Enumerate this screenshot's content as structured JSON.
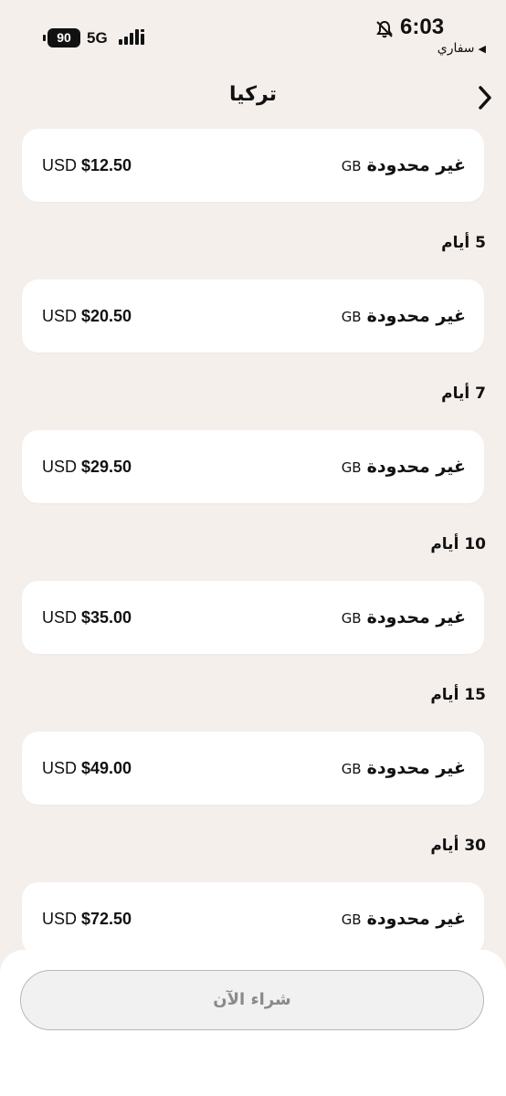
{
  "status_bar": {
    "battery": "90",
    "network": "5G",
    "time": "6:03",
    "back_app": "سفاري",
    "icons": [
      "battery-icon",
      "signal-icon",
      "bell-slash-icon",
      "back-triangle-icon"
    ]
  },
  "nav": {
    "title": "تركيا",
    "back_icon": "chevron-right-icon"
  },
  "plans": [
    {
      "days": "",
      "data": "غير محدودة",
      "unit": "GB",
      "currency": "USD",
      "price": "$12.50"
    },
    {
      "days": "5 أيام",
      "data": "غير محدودة",
      "unit": "GB",
      "currency": "USD",
      "price": "$20.50"
    },
    {
      "days": "7 أيام",
      "data": "غير محدودة",
      "unit": "GB",
      "currency": "USD",
      "price": "$29.50"
    },
    {
      "days": "10 أيام",
      "data": "غير محدودة",
      "unit": "GB",
      "currency": "USD",
      "price": "$35.00"
    },
    {
      "days": "15 أيام",
      "data": "غير محدودة",
      "unit": "GB",
      "currency": "USD",
      "price": "$49.00"
    },
    {
      "days": "30 أيام",
      "data": "غير محدودة",
      "unit": "GB",
      "currency": "USD",
      "price": "$72.50"
    }
  ],
  "footer": {
    "buy_label": "شراء الآن"
  },
  "colors": {
    "background": "#f5efec",
    "card": "#ffffff",
    "button_border": "#b8b8b8",
    "button_text": "#8a8a8a"
  }
}
